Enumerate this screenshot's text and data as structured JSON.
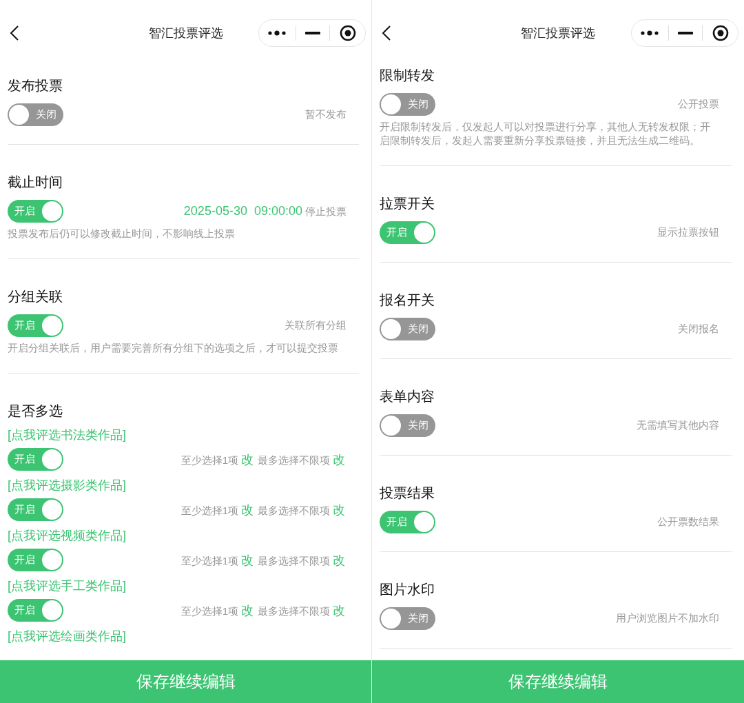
{
  "screens": [
    {
      "title": "智汇投票评选",
      "sections": [
        {
          "kind": "toggle",
          "title": "发布投票",
          "toggle": {
            "on": false,
            "label": "关闭"
          },
          "note": "暂不发布"
        },
        {
          "kind": "toggle",
          "title": "截止时间",
          "toggle": {
            "on": true,
            "label": "开启"
          },
          "value": "2025-05-30  09:00:00",
          "note": "停止投票",
          "hint": "投票发布后仍可以修改截止时间，不影响线上投票"
        },
        {
          "kind": "toggle",
          "title": "分组关联",
          "toggle": {
            "on": true,
            "label": "开启"
          },
          "note": "关联所有分组",
          "hint": "开启分组关联后，用户需要完善所有分组下的选项之后，才可以提交投票"
        },
        {
          "kind": "multi",
          "title": "是否多选",
          "groups": [
            {
              "label": "[点我评选书法类作品]",
              "toggle": {
                "on": true,
                "label": "开启"
              },
              "min_text": "至少选择1项",
              "min_edit": "改",
              "max_text": "最多选择不限项",
              "max_edit": "改"
            },
            {
              "label": "[点我评选摄影类作品]",
              "toggle": {
                "on": true,
                "label": "开启"
              },
              "min_text": "至少选择1项",
              "min_edit": "改",
              "max_text": "最多选择不限项",
              "max_edit": "改"
            },
            {
              "label": "[点我评选视频类作品]",
              "toggle": {
                "on": true,
                "label": "开启"
              },
              "min_text": "至少选择1项",
              "min_edit": "改",
              "max_text": "最多选择不限项",
              "max_edit": "改"
            },
            {
              "label": "[点我评选手工类作品]",
              "toggle": {
                "on": true,
                "label": "开启"
              },
              "min_text": "至少选择1项",
              "min_edit": "改",
              "max_text": "最多选择不限项",
              "max_edit": "改"
            },
            {
              "label": "[点我评选绘画类作品]"
            }
          ]
        }
      ],
      "save_button": "保存继续编辑"
    },
    {
      "title": "智汇投票评选",
      "sections": [
        {
          "kind": "toggle",
          "title": "限制转发",
          "toggle": {
            "on": false,
            "label": "关闭"
          },
          "note": "公开投票",
          "hint": "开启限制转发后，仅发起人可以对投票进行分享，其他人无转发权限；开启限制转发后，发起人需要重新分享投票链接，并且无法生成二维码。"
        },
        {
          "kind": "toggle",
          "title": "拉票开关",
          "toggle": {
            "on": true,
            "label": "开启"
          },
          "note": "显示拉票按钮"
        },
        {
          "kind": "toggle",
          "title": "报名开关",
          "toggle": {
            "on": false,
            "label": "关闭"
          },
          "note": "关闭报名"
        },
        {
          "kind": "toggle",
          "title": "表单内容",
          "toggle": {
            "on": false,
            "label": "关闭"
          },
          "note": "无需填写其他内容"
        },
        {
          "kind": "toggle",
          "title": "投票结果",
          "toggle": {
            "on": true,
            "label": "开启"
          },
          "note": "公开票数结果"
        },
        {
          "kind": "toggle",
          "title": "图片水印",
          "toggle": {
            "on": false,
            "label": "关闭"
          },
          "note": "用户浏览图片不加水印"
        }
      ],
      "save_button": "保存继续编辑"
    }
  ]
}
